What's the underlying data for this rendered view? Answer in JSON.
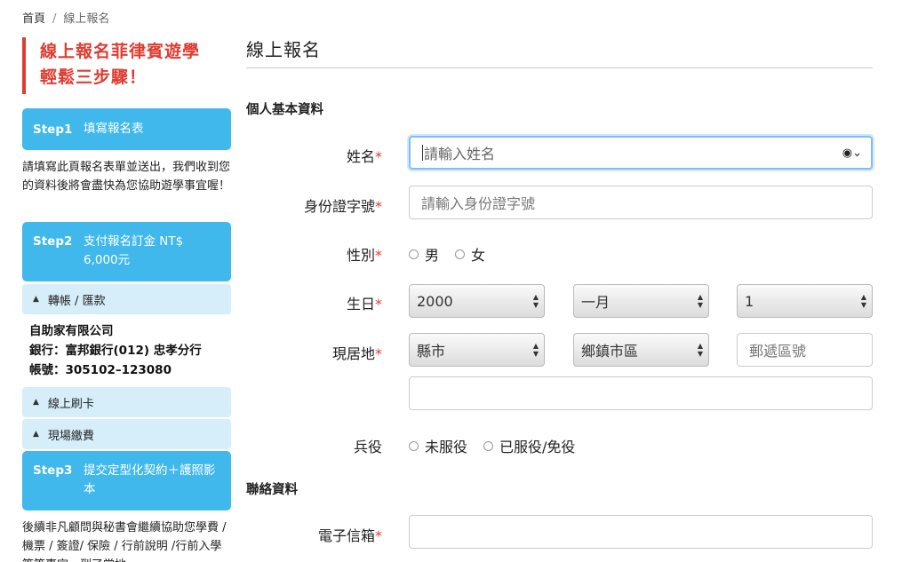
{
  "breadcrumb": {
    "home": "首頁",
    "sep": "/",
    "current": "線上報名"
  },
  "sidebar": {
    "promo_line1": "線上報名菲律賓遊學",
    "promo_line2": "輕鬆三步驟！",
    "step1": {
      "num": "Step1",
      "text": "填寫報名表"
    },
    "step1_desc": "請填寫此頁報名表單並送出，我們收到您的資料後將會盡快為您協助遊學事宜喔！",
    "step2": {
      "num": "Step2",
      "text": "支付報名訂金 NT$ 6,000元"
    },
    "acc_transfer": "轉帳 / 匯款",
    "bank": {
      "company": "自助家有限公司",
      "bank": "銀行：富邦銀行(012) 忠孝分行",
      "account": "帳號：305102–123080"
    },
    "acc_card": "線上刷卡",
    "acc_onsite": "現場繳費",
    "step3": {
      "num": "Step3",
      "text": "提交定型化契約＋護照影本"
    },
    "step3_desc": "後續非凡顧問與秘書會繼續協助您學費 / 機票 / 簽證/ 保險 / 行前說明 /行前入學等等事宜，到了當地"
  },
  "main": {
    "title": "線上報名",
    "section_personal": "個人基本資料",
    "section_contact": "聯絡資料",
    "required_mark": "*",
    "name": {
      "label": "姓名",
      "placeholder": "請輸入姓名"
    },
    "id_number": {
      "label": "身份證字號",
      "placeholder": "請輸入身份證字號"
    },
    "gender": {
      "label": "性別",
      "options": [
        "男",
        "女"
      ]
    },
    "birthday": {
      "label": "生日",
      "year": "2000",
      "month": "一月",
      "day": "1"
    },
    "address": {
      "label": "現居地",
      "county": "縣市",
      "town": "鄉鎮市區",
      "zip_placeholder": "郵遞區號",
      "street": ""
    },
    "military": {
      "label": "兵役",
      "options": [
        "未服役",
        "已服役/免役"
      ]
    },
    "email": {
      "label": "電子信箱",
      "value": ""
    }
  }
}
